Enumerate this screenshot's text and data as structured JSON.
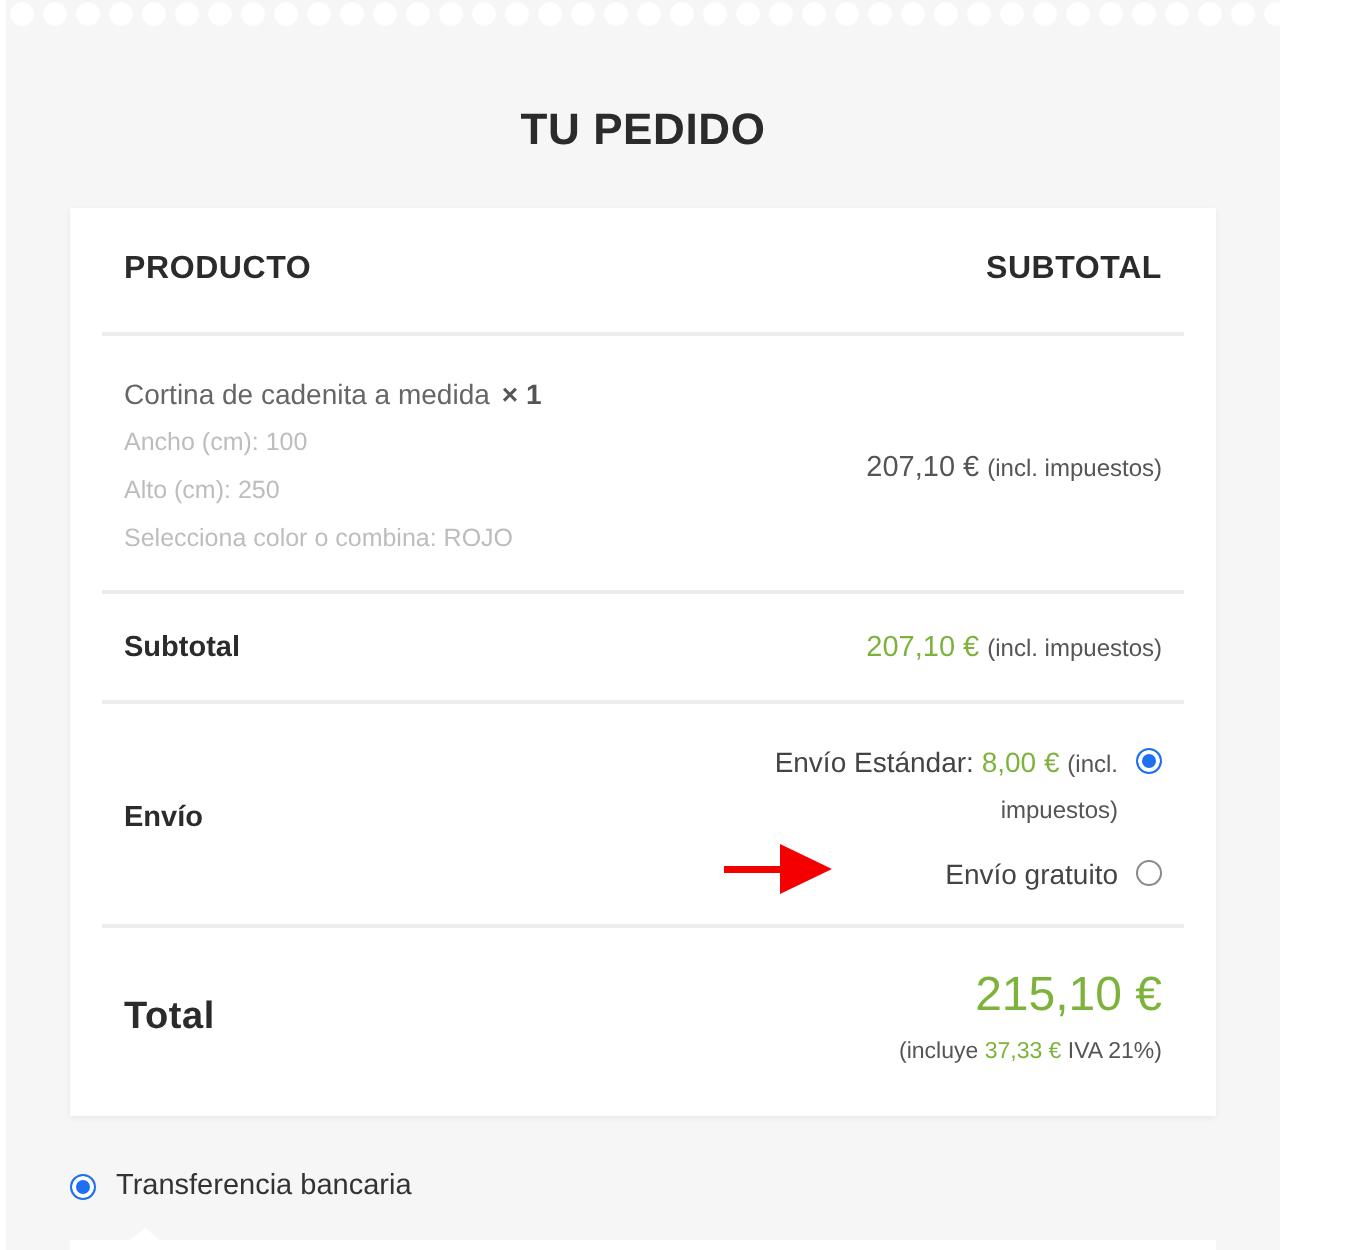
{
  "title": "TU PEDIDO",
  "order": {
    "columns": [
      "PRODUCTO",
      "SUBTOTAL"
    ],
    "items": [
      {
        "name": "Cortina de cadenita a medida",
        "quantity": "× 1",
        "meta": [
          "Ancho (cm): 100",
          "Alto (cm): 250",
          "Selecciona color o combina: ROJO"
        ],
        "price": "207,10 €",
        "tax_note": "(incl. impuestos)"
      }
    ],
    "subtotal": {
      "label": "Subtotal",
      "amount": "207,10 €",
      "tax_note": "(incl. impuestos)"
    },
    "shipping": {
      "label": "Envío",
      "options": [
        {
          "label": "Envío Estándar:",
          "price": "8,00 €",
          "tax_note": "(incl. impuestos)",
          "selected": true
        },
        {
          "label": "Envío gratuito",
          "selected": false
        }
      ]
    },
    "total": {
      "label": "Total",
      "amount": "215,10 €",
      "tax_before": "(incluye",
      "tax_amount": "37,33 €",
      "tax_after": "IVA 21%)"
    }
  },
  "payment_methods": [
    {
      "label": "Transferencia bancaria",
      "selected": true
    }
  ]
}
